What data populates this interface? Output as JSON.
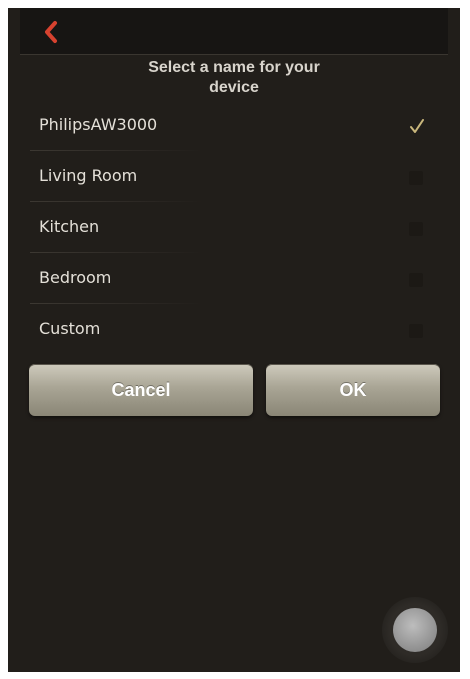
{
  "header": {
    "back_icon": "chevron-left-icon",
    "back_color": "#d7422f"
  },
  "dialog": {
    "title_line1": "Select a name for your",
    "title_line2": "device"
  },
  "options": [
    {
      "label": "PhilipsAW3000",
      "selected": true
    },
    {
      "label": "Living Room",
      "selected": false
    },
    {
      "label": "Kitchen",
      "selected": false
    },
    {
      "label": "Bedroom",
      "selected": false
    },
    {
      "label": "Custom",
      "selected": false
    }
  ],
  "buttons": {
    "cancel_label": "Cancel",
    "ok_label": "OK"
  },
  "colors": {
    "background": "#211e1a",
    "check": "#c9b77c",
    "button_face": "#a9a595"
  },
  "home_button_icon": "home-button-icon"
}
